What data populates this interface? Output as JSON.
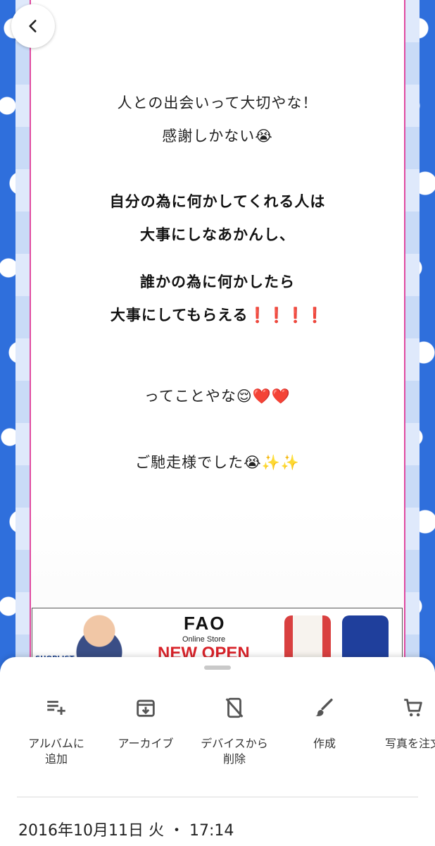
{
  "message": {
    "line1": "人との出会いって大切やな！",
    "line2_text": "感謝しかない",
    "line2_emoji": "😭",
    "line3": "自分の為に何かしてくれる人は",
    "line4": "大事にしなあかんし、",
    "line5": "誰かの為に何かしたら",
    "line6_text": "大事にしてもらえる",
    "line6_marks": "❗❗❗❗",
    "line7_text": "ってことやな",
    "line7_emoji": "😌",
    "line7_hearts": "❤️❤️",
    "line8_text": "ご馳走様でした",
    "line8_emoji": "😭",
    "line8_sparkles": "✨✨"
  },
  "ad": {
    "shoplist": "SHOPLIST",
    "brand": "FAO",
    "store": "Online Store",
    "headline": "NEW OPEN"
  },
  "actions": [
    {
      "label_line1": "アルバムに",
      "label_line2": "追加",
      "icon": "playlist-add-icon"
    },
    {
      "label_line1": "アーカイブ",
      "label_line2": "",
      "icon": "archive-icon"
    },
    {
      "label_line1": "デバイスから",
      "label_line2": "削除",
      "icon": "device-remove-icon"
    },
    {
      "label_line1": "作成",
      "label_line2": "",
      "icon": "brush-icon"
    },
    {
      "label_line1": "写真を注文",
      "label_line2": "",
      "icon": "cart-icon"
    }
  ],
  "info": {
    "date": "2016年10月11日 火 ・ 17:14"
  },
  "colors": {
    "accent_border": "#e04aa0",
    "background_blue": "#2f6fdc",
    "exclaim_red": "#e02424"
  }
}
